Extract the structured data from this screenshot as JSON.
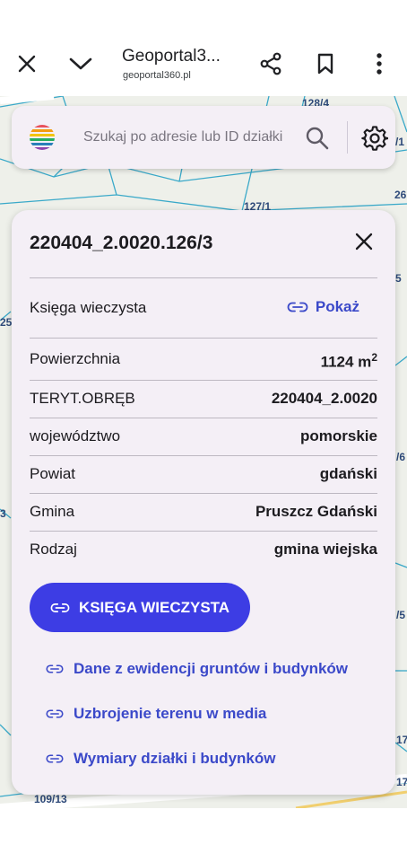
{
  "browser": {
    "title": "Geoportal3...",
    "url": "geoportal360.pl",
    "icons": [
      "close-icon",
      "chevron-down-icon",
      "share-icon",
      "bookmark-icon",
      "more-vert-icon"
    ]
  },
  "map": {
    "labels": [
      "128/4",
      "127/1",
      "/1",
      "26",
      "25",
      "/6",
      "/5",
      "17",
      "17",
      "109/13",
      "3",
      "5"
    ],
    "colors": {
      "background": "#eef0ea",
      "parcel_lines": "#3aa9c9",
      "road": "#ffffff"
    }
  },
  "search": {
    "placeholder": "Szukaj po adresie lub ID działki",
    "icons": [
      "app-logo",
      "search-icon",
      "gear-icon"
    ]
  },
  "card": {
    "title": "220404_2.0020.126/3",
    "land_register": {
      "label": "Księga wieczysta",
      "link": "Pokaż"
    },
    "rows": [
      {
        "label": "Powierzchnia",
        "value": "1124 m",
        "sup": "2"
      },
      {
        "label": "TERYT.OBRĘB",
        "value": "220404_2.0020"
      },
      {
        "label": "województwo",
        "value": "pomorskie"
      },
      {
        "label": "Powiat",
        "value": "gdański"
      },
      {
        "label": "Gmina",
        "value": "Pruszcz Gdański"
      },
      {
        "label": "Rodzaj",
        "value": "gmina wiejska"
      }
    ],
    "primary_button": "KSIĘGA WIECZYSTA",
    "links": [
      "Dane z ewidencji gruntów i budynków",
      "Uzbrojenie terenu w media",
      "Wymiary działki i budynków"
    ],
    "colors": {
      "accent": "#3b49c9",
      "button": "#3d3de4",
      "surface": "#f4eff6"
    }
  }
}
